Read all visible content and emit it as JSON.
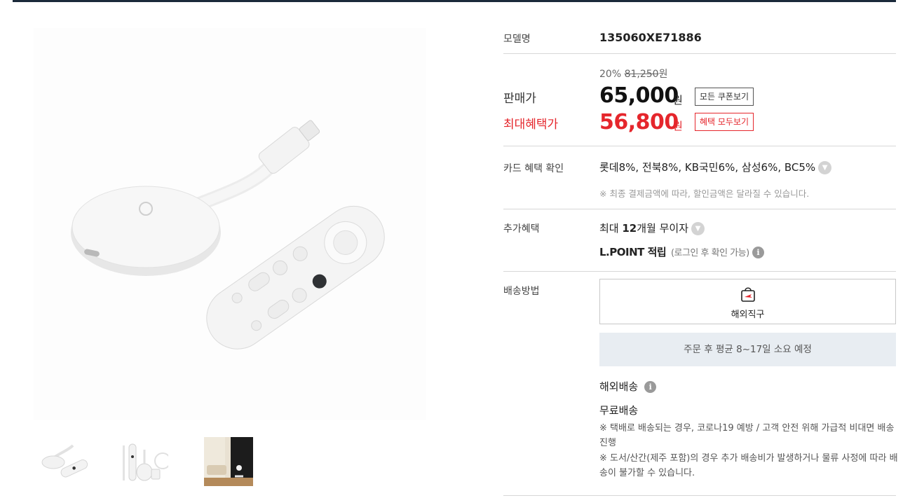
{
  "model": {
    "label": "모델명",
    "value": "135060XE71886"
  },
  "price": {
    "discount_rate": "20%",
    "original": "81,250",
    "original_unit": "원",
    "sale_label": "판매가",
    "sale_value": "65,000",
    "currency": "원",
    "coupon_button": "모든 쿠폰보기",
    "max_label": "최대혜택가",
    "max_value": "56,800",
    "benefit_button": "혜택 모두보기"
  },
  "card": {
    "label": "카드 혜택 확인",
    "value": "롯데8%, 전북8%, KB국민6%, 삼성6%, BC5%",
    "note": "※ 최종 결제금액에 따라, 할인금액은 달라질 수 있습니다."
  },
  "extra": {
    "label": "추가혜택",
    "inst_prefix": "최대 ",
    "inst_bold": "12",
    "inst_suffix": "개월 무이자",
    "lpoint": "L.POINT 적립",
    "lpoint_sub": "(로그인 후 확인 가능)"
  },
  "shipping": {
    "label": "배송방법",
    "method": "해외직구",
    "eta": "주문 후 평균 8~17일 소요 예정",
    "type": "해외배송",
    "fee": "무료배송",
    "note1": "※ 택배로 배송되는 경우, 코로나19 예방 / 고객 안전 위해 가급적 비대면 배송 진행",
    "note2": "※ 도서/산간(제주 포함)의 경우 추가 배송비가 발생하거나 물류 사정에 따라 배송이 불가할 수 있습니다."
  },
  "colors": {
    "accent_red": "#e5262c",
    "eta_bg": "#e8edf2"
  }
}
